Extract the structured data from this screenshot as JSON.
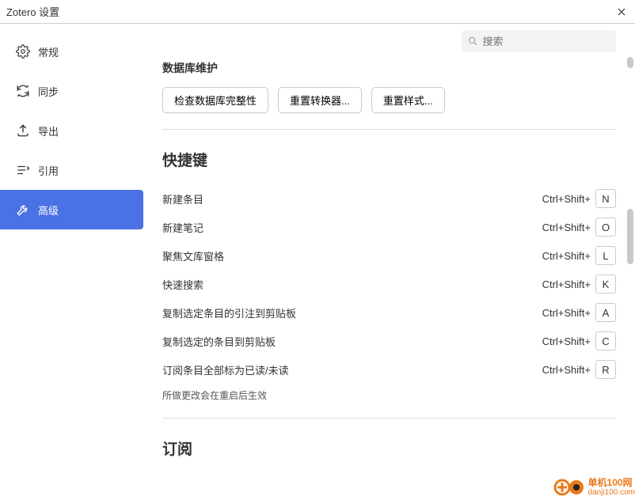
{
  "window": {
    "title": "Zotero 设置"
  },
  "sidebar": {
    "items": [
      {
        "label": "常规"
      },
      {
        "label": "同步"
      },
      {
        "label": "导出"
      },
      {
        "label": "引用"
      },
      {
        "label": "高级"
      }
    ]
  },
  "search": {
    "placeholder": "搜索"
  },
  "sections": {
    "db": {
      "title": "数据库维护",
      "buttons": {
        "check": "检查数据库完整性",
        "resetTranslators": "重置转换器...",
        "resetStyles": "重置样式..."
      }
    },
    "shortcuts": {
      "title": "快捷键",
      "modifier": "Ctrl+Shift+",
      "rows": [
        {
          "label": "新建条目",
          "key": "N"
        },
        {
          "label": "新建笔记",
          "key": "O"
        },
        {
          "label": "聚焦文库窗格",
          "key": "L"
        },
        {
          "label": "快速搜索",
          "key": "K"
        },
        {
          "label": "复制选定条目的引注到剪贴板",
          "key": "A"
        },
        {
          "label": "复制选定的条目到剪贴板",
          "key": "C"
        },
        {
          "label": "订阅条目全部标为已读/未读",
          "key": "R"
        }
      ],
      "note": "所做更改会在重启后生效"
    },
    "subscribe": {
      "title": "订阅"
    }
  },
  "watermark": {
    "line1": "单机100网",
    "line2": "danji100.com"
  }
}
